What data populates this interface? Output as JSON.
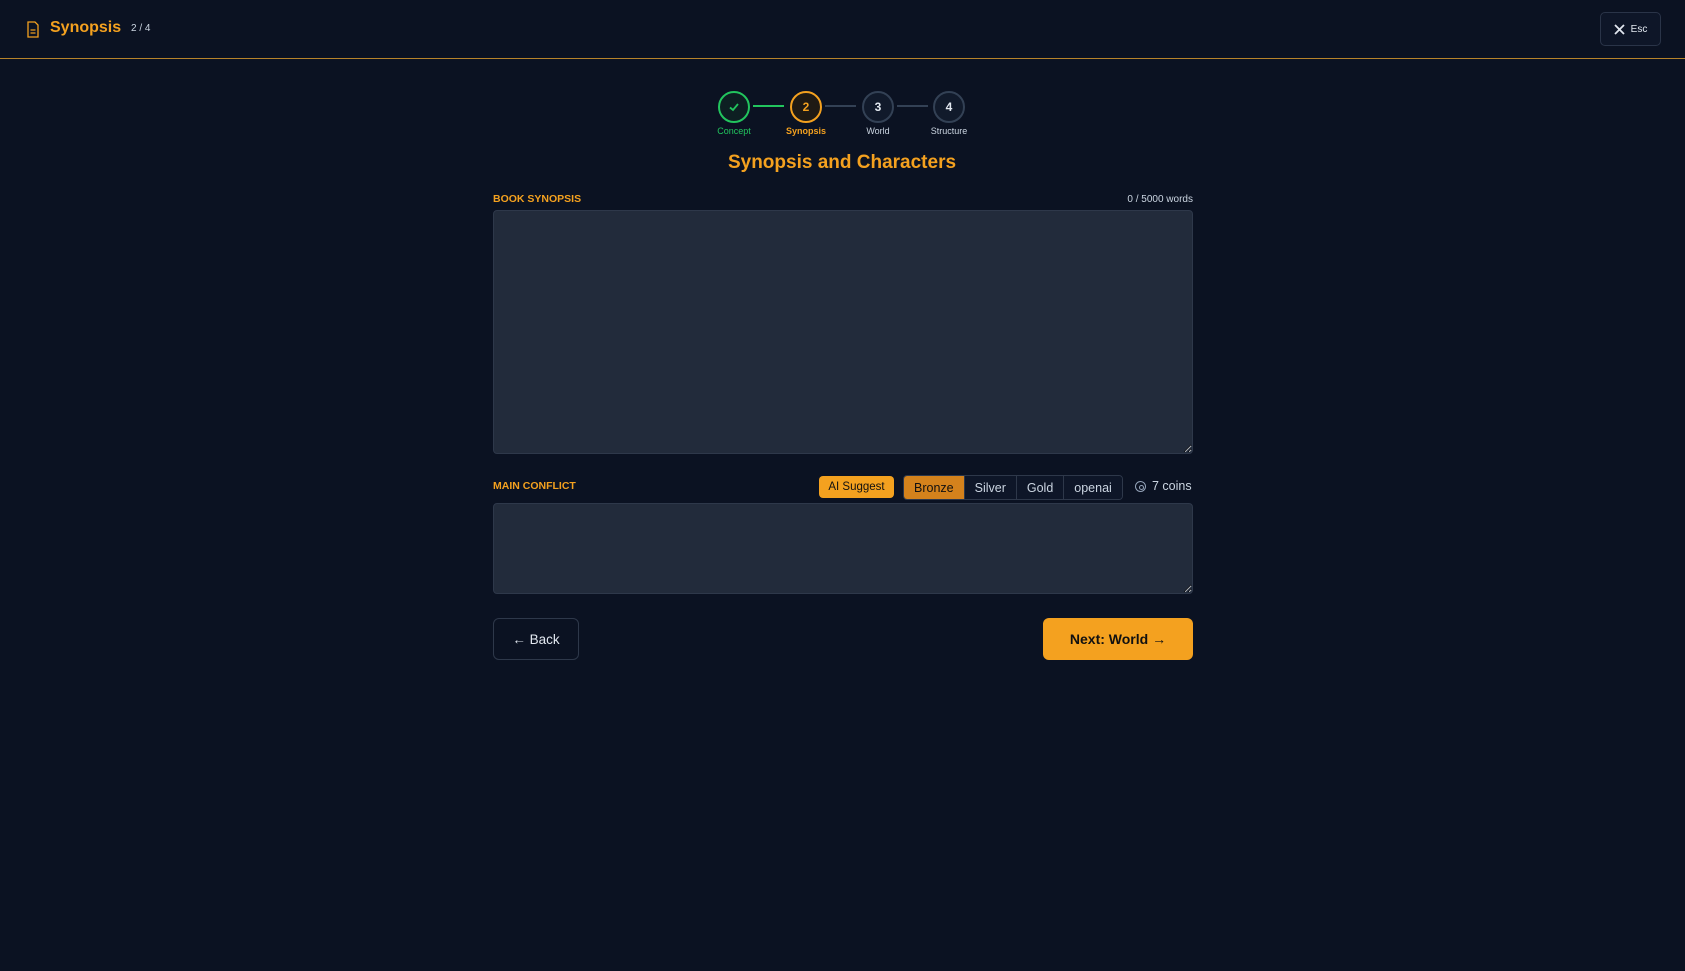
{
  "header": {
    "title": "Synopsis",
    "step_count": "2 / 4",
    "icon": "document-icon",
    "esc_label": "Esc"
  },
  "stepper": {
    "steps": [
      {
        "number": "✓",
        "label": "Concept",
        "status": "done"
      },
      {
        "number": "2",
        "label": "Synopsis",
        "status": "active"
      },
      {
        "number": "3",
        "label": "World",
        "status": "todo"
      },
      {
        "number": "4",
        "label": "Structure",
        "status": "todo"
      }
    ]
  },
  "main": {
    "title": "Synopsis and Characters",
    "synopsis": {
      "label": "BOOK SYNOPSIS",
      "word_count": "0 / 5000 words",
      "value": ""
    },
    "conflict": {
      "label": "MAIN CONFLICT",
      "ai_suggest_label": "AI Suggest",
      "tiers": [
        "Bronze",
        "Silver",
        "Gold",
        "openai"
      ],
      "selected_tier": "Bronze",
      "coins": "7 coins",
      "value": ""
    },
    "back_label": "← Back",
    "next_label": "Next: World →"
  },
  "colors": {
    "accent": "#f4a11f",
    "done": "#22c55e",
    "background": "#0b1222"
  }
}
